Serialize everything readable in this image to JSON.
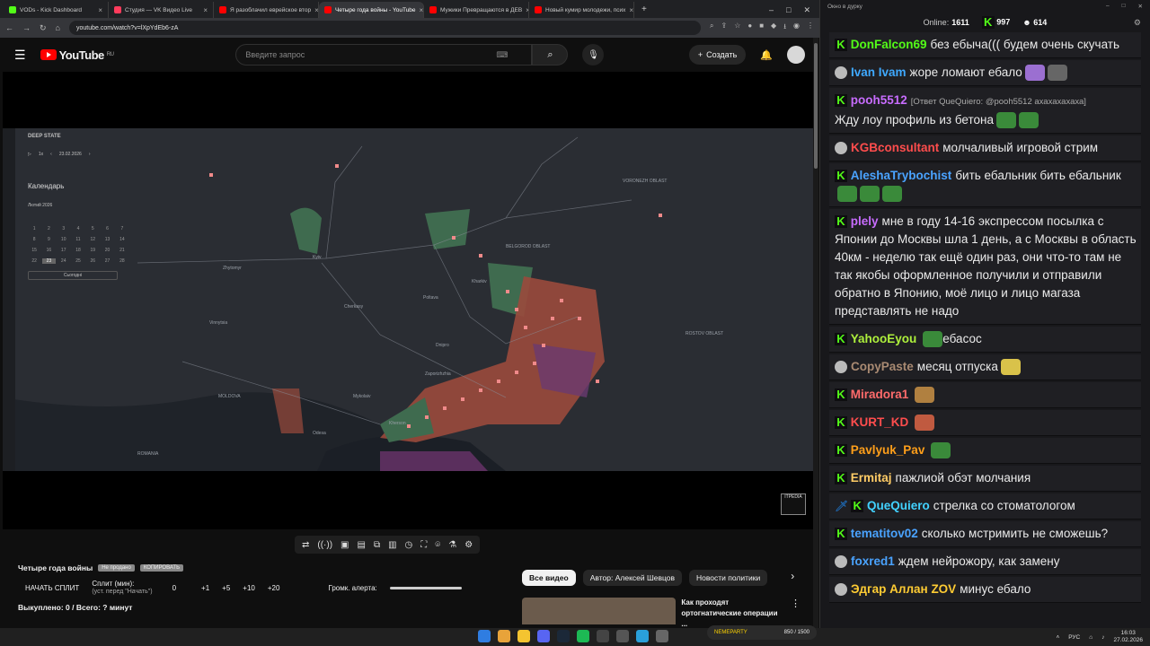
{
  "browser": {
    "tabs": [
      {
        "title": "VODs - Kick Dashboard",
        "color": "#53fc18",
        "active": false
      },
      {
        "title": "Студия — VK Видео Live",
        "color": "#ff3b5c",
        "active": false
      },
      {
        "title": "Я разоблачил еврейское втор",
        "color": "#ff0000",
        "active": false
      },
      {
        "title": "Четыре года войны - YouTube",
        "color": "#ff0000",
        "active": true
      },
      {
        "title": "Мужики Превращаются в ДЕВ",
        "color": "#ff0000",
        "active": false
      },
      {
        "title": "Новый кумир молодежи, псих",
        "color": "#ff0000",
        "active": false
      }
    ],
    "url": "youtube.com/watch?v=lXpYdEb6-zA"
  },
  "youtube": {
    "logo_text": "YouTube",
    "logo_region": "RU",
    "search_placeholder": "Введите запрос",
    "create_label": "Создать"
  },
  "map": {
    "brand": "DEEP STATE",
    "date": "23.02.2026",
    "zoom": "1x",
    "calendar_title": "Календарь",
    "month": "Лютий  2026",
    "days": [
      "1",
      "2",
      "3",
      "4",
      "5",
      "6",
      "7",
      "8",
      "9",
      "10",
      "11",
      "12",
      "13",
      "14",
      "15",
      "16",
      "17",
      "18",
      "19",
      "20",
      "21",
      "22",
      "23",
      "24",
      "25",
      "26",
      "27",
      "28"
    ],
    "today_label": "Сьогодні",
    "places": [
      "Kyiv",
      "Zhytomyr",
      "Vinnytsia",
      "Kharkiv",
      "Poltava",
      "Cherkasy",
      "Dnipro",
      "Zaporizhzhia",
      "Odesa",
      "Mykolaiv",
      "Kherson",
      "ROMANIA",
      "MOLDOVA",
      "BELGOROD OBLAST",
      "VORONEZH OBLAST",
      "ROSTOV OBLAST"
    ],
    "watermark": "ITPEDIA"
  },
  "below": {
    "title": "Четыре года войны",
    "pill1": "Не продано",
    "pill2": "КОПИРОВАТЬ",
    "split_button": "НАЧАТЬ СПЛИТ",
    "split_label": "Сплит (мин):",
    "split_hint": "(уст. перед \"Начать\")",
    "split_value": "0",
    "increments": [
      "+1",
      "+5",
      "+10",
      "+20"
    ],
    "alert_label": "Громк. алерта:",
    "summary": "Выкуплено: 0 / Всего: ? минут"
  },
  "chips": [
    "Все видео",
    "Автор: Алексей Шевцов",
    "Новости политики"
  ],
  "recommend": {
    "title_line1": "Как проходят",
    "title_line2": "ортогнатические операции ..."
  },
  "chat": {
    "window_title": "Окно в дурку",
    "online_label": "Online:",
    "online_value": "1611",
    "kick_count": "997",
    "other_count": "614",
    "messages": [
      {
        "user": "DonFalcon69",
        "color": "#53fc18",
        "text": "без ебыча((( будем очень скучать",
        "platform": "kick"
      },
      {
        "user": "Ivan Ivam",
        "color": "#3fa9ff",
        "text": "жоре ломают ебало",
        "platform": "vk"
      },
      {
        "user": "pooh5512",
        "color": "#c86cff",
        "reply": "[Ответ QueQuiero: @pooh5512 ахахахахаха]",
        "text": "Жду лоу профиль из бетона",
        "platform": "kick"
      },
      {
        "user": "KGBconsultant",
        "color": "#ff4d4d",
        "text": "молчаливый игровой стрим",
        "platform": "vk"
      },
      {
        "user": "AleshaTrybochist",
        "color": "#4aa3ff",
        "text": "бить ебальник бить ебальник",
        "platform": "kick"
      },
      {
        "user": "plely",
        "color": "#c86cff",
        "text": "мне в году 14-16 экспрессом посылка с Японии до Москвы шла 1 день, а с Москвы в область 40км - неделю так ещё один раз, они что-то там не так якобы оформленное получили и отправили обратно в Японию, моё лицо и лицо магаза представлять не надо",
        "platform": "kick"
      },
      {
        "user": "YahooEyou",
        "color": "#aef03c",
        "text": "ебасос",
        "platform": "kick"
      },
      {
        "user": "CopyPaste",
        "color": "#a98a72",
        "text": "месяц отпуска",
        "platform": "vk"
      },
      {
        "user": "Miradora1",
        "color": "#ff6b6b",
        "text": "",
        "platform": "kick"
      },
      {
        "user": "KURT_KD",
        "color": "#ff4d4d",
        "text": "",
        "platform": "kick"
      },
      {
        "user": "Pavlyuk_Pav",
        "color": "#ff9f1a",
        "text": "",
        "platform": "kick"
      },
      {
        "user": "Ermitaj",
        "color": "#ffcc66",
        "text": "пажлиой обэт молчания",
        "platform": "kick"
      },
      {
        "user": "QueQuiero",
        "color": "#42d2ff",
        "text": "стрелка со стоматологом",
        "platform": "kick"
      },
      {
        "user": "tematitov02",
        "color": "#4aa3ff",
        "text": "сколько мстримить не сможешь?",
        "platform": "kick"
      },
      {
        "user": "foxred1",
        "color": "#4aa3ff",
        "text": "ждем нейрожору, как замену",
        "platform": "vk"
      },
      {
        "user": "Эдгар Аллан ZOV",
        "color": "#ffcc33",
        "text": "минус ебало",
        "platform": "vk"
      }
    ]
  },
  "taskbar": {
    "lang": "РУС",
    "time": "16:03",
    "date": "27.02.2026",
    "nemechip_label": "NEMEPARTY",
    "nemechip_value": "850 / 1500"
  }
}
